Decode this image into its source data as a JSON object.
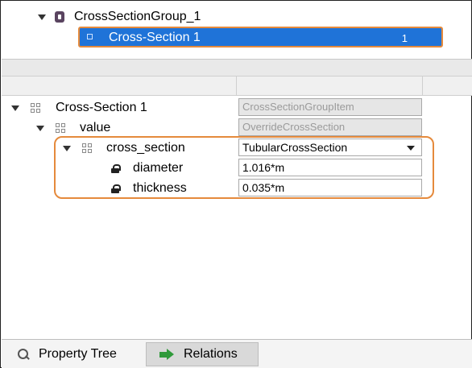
{
  "top_tree": {
    "group_label": "CrossSectionGroup_1",
    "selected_item": {
      "label": "Cross-Section 1",
      "count": "1"
    }
  },
  "property_tree": {
    "root": {
      "name": "Cross-Section 1",
      "type": "CrossSectionGroupItem"
    },
    "value": {
      "name": "value",
      "type": "OverrideCrossSection"
    },
    "cross_section": {
      "name": "cross_section",
      "value": "TubularCrossSection"
    },
    "diameter": {
      "name": "diameter",
      "value": "1.016*m"
    },
    "thickness": {
      "name": "thickness",
      "value": "0.035*m"
    }
  },
  "tabs": {
    "property_tree": "Property Tree",
    "relations": "Relations"
  },
  "colors": {
    "selection": "#1f73d8",
    "highlight_outline": "#e58a3c",
    "group_icon": "#5a4460",
    "relations_icon": "#2f9a3a"
  },
  "icons": {
    "group": "group-icon",
    "item": "square-icon",
    "grid": "grid-icon",
    "lock": "lock-icon",
    "search": "search-icon",
    "relations": "arrow-right-icon"
  }
}
